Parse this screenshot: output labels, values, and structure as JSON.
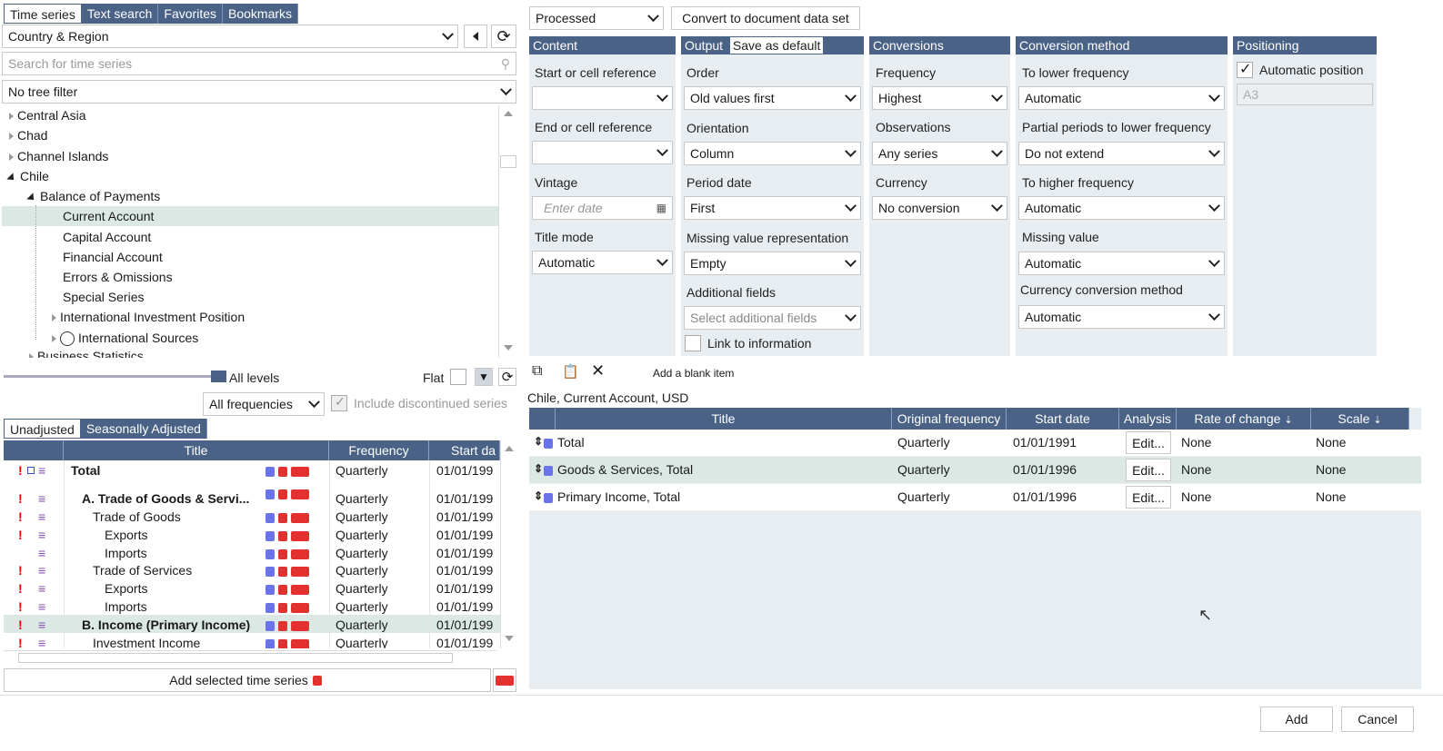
{
  "top_tabs": [
    "Time series",
    "Text search",
    "Favorites",
    "Bookmarks"
  ],
  "region_dropdown": "Country & Region",
  "search_placeholder": "Search for time series",
  "tree_filter": "No tree filter",
  "tree": {
    "central_asia": "Central Asia",
    "chad": "Chad",
    "channel_islands": "Channel Islands",
    "chile": "Chile",
    "bop": "Balance of Payments",
    "current_account": "Current Account",
    "capital_account": "Capital Account",
    "financial_account": "Financial Account",
    "errors": "Errors & Omissions",
    "special": "Special Series",
    "iip": "International Investment Position",
    "intl_sources": "International Sources",
    "business_stats": "Business Statistics"
  },
  "levels": {
    "all_levels": "All levels",
    "flat": "Flat"
  },
  "frequencies_dropdown": "All frequencies",
  "include_discontinued": "Include discontinued series",
  "adj_tabs": [
    "Unadjusted",
    "Seasonally Adjusted"
  ],
  "series_table": {
    "headers": [
      "Title",
      "Frequency",
      "Start da"
    ],
    "rows": [
      {
        "title": "Total",
        "freq": "Quarterly",
        "start": "01/01/199"
      },
      {
        "title": "A. Trade of Goods & Servi...",
        "freq": "Quarterly",
        "start": "01/01/199"
      },
      {
        "title": "Trade of Goods",
        "freq": "Quarterly",
        "start": "01/01/199"
      },
      {
        "title": "Exports",
        "freq": "Quarterly",
        "start": "01/01/199"
      },
      {
        "title": "Imports",
        "freq": "Quarterly",
        "start": "01/01/199"
      },
      {
        "title": "Trade of Services",
        "freq": "Quarterly",
        "start": "01/01/199"
      },
      {
        "title": "Exports",
        "freq": "Quarterly",
        "start": "01/01/199"
      },
      {
        "title": "Imports",
        "freq": "Quarterly",
        "start": "01/01/199"
      },
      {
        "title": "B. Income (Primary Income)",
        "freq": "Quarterly",
        "start": "01/01/199"
      },
      {
        "title": "Investment Income",
        "freq": "Quarterly",
        "start": "01/01/199"
      }
    ]
  },
  "add_selected": "Add selected time series",
  "processed_dropdown": "Processed",
  "convert_button": "Convert to document data set",
  "content_panel": {
    "header": "Content",
    "start_label": "Start or cell reference",
    "end_label": "End or cell reference",
    "vintage_label": "Vintage",
    "vintage_placeholder": "Enter date",
    "title_mode_label": "Title mode",
    "title_mode_value": "Automatic"
  },
  "output_panel": {
    "header": "Output",
    "save_default": "Save as default",
    "order_label": "Order",
    "order_value": "Old values first",
    "orientation_label": "Orientation",
    "orientation_value": "Column",
    "period_label": "Period date",
    "period_value": "First",
    "missing_label": "Missing value representation",
    "missing_value": "Empty",
    "additional_label": "Additional fields",
    "additional_placeholder": "Select additional fields",
    "link_label": "Link to information"
  },
  "conversions_panel": {
    "header": "Conversions",
    "freq_label": "Frequency",
    "freq_value": "Highest",
    "obs_label": "Observations",
    "obs_value": "Any series",
    "currency_label": "Currency",
    "currency_value": "No conversion"
  },
  "method_panel": {
    "header": "Conversion method",
    "lower_label": "To lower frequency",
    "lower_value": "Automatic",
    "partial_label": "Partial periods to lower frequency",
    "partial_value": "Do not extend",
    "higher_label": "To higher frequency",
    "higher_value": "Automatic",
    "missing_label": "Missing value",
    "missing_value": "Automatic",
    "currency_method_label": "Currency conversion method",
    "currency_method_value": "Automatic"
  },
  "positioning_panel": {
    "header": "Positioning",
    "auto_label": "Automatic position",
    "cell": "A3"
  },
  "add_blank": "Add a blank item",
  "selection_title": "Chile, Current Account, USD",
  "selected_table": {
    "headers": [
      "Title",
      "Original frequency",
      "Start date",
      "Analysis",
      "Rate of change",
      "Scale"
    ],
    "rows": [
      {
        "title": "Total",
        "freq": "Quarterly",
        "start": "01/01/1991",
        "analysis": "Edit...",
        "rate": "None",
        "scale": "None"
      },
      {
        "title": "Goods & Services, Total",
        "freq": "Quarterly",
        "start": "01/01/1996",
        "analysis": "Edit...",
        "rate": "None",
        "scale": "None"
      },
      {
        "title": "Primary Income, Total",
        "freq": "Quarterly",
        "start": "01/01/1996",
        "analysis": "Edit...",
        "rate": "None",
        "scale": "None"
      }
    ]
  },
  "footer": {
    "add": "Add",
    "cancel": "Cancel"
  }
}
